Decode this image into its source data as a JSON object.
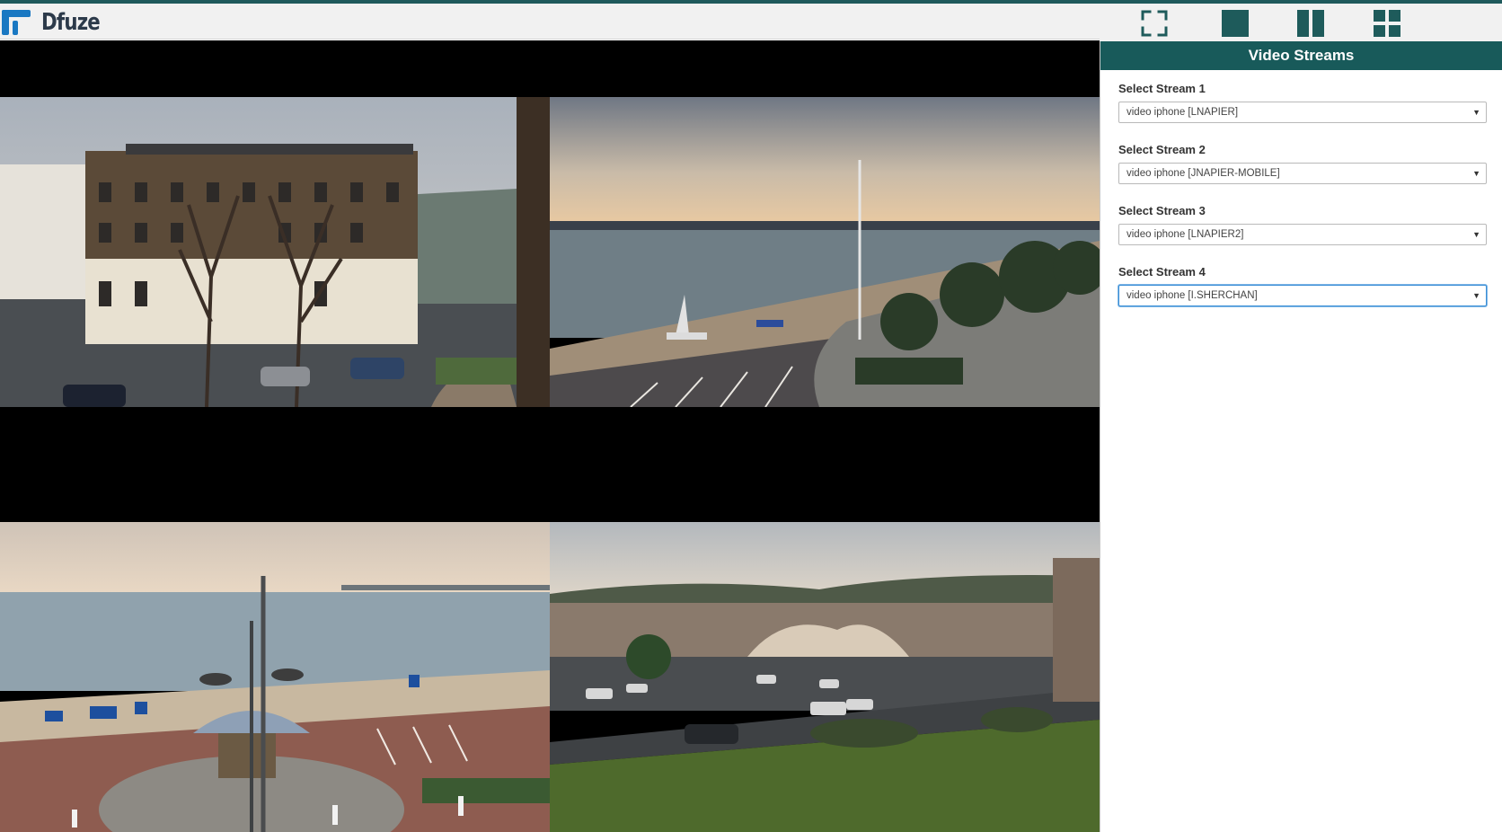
{
  "app": {
    "logo_text": "Dfuze"
  },
  "layout_buttons": [
    {
      "name": "fullscreen",
      "icon": "fullscreen-icon"
    },
    {
      "name": "single-view",
      "icon": "single-square-icon"
    },
    {
      "name": "two-column-view",
      "icon": "two-columns-icon"
    },
    {
      "name": "quad-view",
      "icon": "four-grid-icon",
      "selected": true
    }
  ],
  "colors": {
    "accent": "#185a5a",
    "logo": "#1a78c2",
    "icons": "#1e5b5b"
  },
  "sidebar": {
    "title": "Video Streams",
    "streams": [
      {
        "label": "Select Stream 1",
        "value": "video iphone [LNAPIER]"
      },
      {
        "label": "Select Stream 2",
        "value": "video iphone [JNAPIER-MOBILE]"
      },
      {
        "label": "Select Stream 3",
        "value": "video iphone [LNAPIER2]"
      },
      {
        "label": "Select Stream 4",
        "value": "video iphone [I.SHERCHAN]",
        "focused": true
      }
    ]
  },
  "video_tiles": [
    {
      "scene": "hotel-street-view"
    },
    {
      "scene": "seafront-promenade"
    },
    {
      "scene": "beach-shelter-view"
    },
    {
      "scene": "town-car-park-view"
    }
  ]
}
